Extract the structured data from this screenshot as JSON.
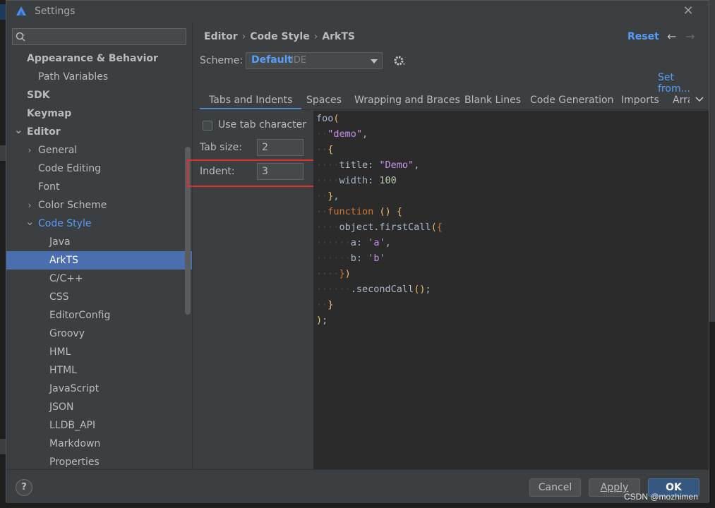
{
  "window": {
    "title": "Settings"
  },
  "search": {
    "placeholder": ""
  },
  "tree": [
    {
      "label": "Appearance & Behavior",
      "bold": true
    },
    {
      "label": "Path Variables"
    },
    {
      "label": "SDK",
      "bold": true
    },
    {
      "label": "Keymap",
      "bold": true
    },
    {
      "label": "Editor",
      "bold": true,
      "expanded": true
    },
    {
      "label": "General",
      "collapsed": true
    },
    {
      "label": "Code Editing"
    },
    {
      "label": "Font"
    },
    {
      "label": "Color Scheme",
      "collapsed": true
    },
    {
      "label": "Code Style",
      "expanded": true
    },
    {
      "label": "Java"
    },
    {
      "label": "ArkTS",
      "selected": true
    },
    {
      "label": "C/C++"
    },
    {
      "label": "CSS"
    },
    {
      "label": "EditorConfig"
    },
    {
      "label": "Groovy"
    },
    {
      "label": "HML"
    },
    {
      "label": "HTML"
    },
    {
      "label": "JavaScript"
    },
    {
      "label": "JSON"
    },
    {
      "label": "LLDB_API"
    },
    {
      "label": "Markdown"
    },
    {
      "label": "Properties"
    }
  ],
  "breadcrumb": [
    "Editor",
    "Code Style",
    "ArkTS"
  ],
  "header": {
    "reset_label": "Reset"
  },
  "scheme": {
    "label": "Scheme:",
    "name": "Default",
    "type": "IDE"
  },
  "set_from_label": "Set from...",
  "tabs": [
    "Tabs and Indents",
    "Spaces",
    "Wrapping and Braces",
    "Blank Lines",
    "Code Generation",
    "Imports",
    "Arra"
  ],
  "active_tab": "Tabs and Indents",
  "options": {
    "use_tab_label": "Use tab character",
    "use_tab_checked": false,
    "tab_size_label": "Tab size:",
    "tab_size_value": "2",
    "indent_label": "Indent:",
    "indent_value": "3"
  },
  "code_lines": [
    [
      [
        "",
        "foo"
      ],
      [
        "par",
        "("
      ]
    ],
    [
      [
        "ws",
        "··"
      ],
      [
        "str",
        "\"demo\""
      ],
      [
        "",
        ","
      ]
    ],
    [
      [
        "ws",
        "··"
      ],
      [
        "par",
        "{"
      ]
    ],
    [
      [
        "ws",
        "····"
      ],
      [
        "",
        "title"
      ],
      [
        "",
        ": "
      ],
      [
        "str",
        "\"Demo\""
      ],
      [
        "",
        ","
      ]
    ],
    [
      [
        "ws",
        "····"
      ],
      [
        "",
        "width"
      ],
      [
        "",
        ": "
      ],
      [
        "num",
        "100"
      ]
    ],
    [
      [
        "ws",
        "··"
      ],
      [
        "par",
        "}"
      ],
      [
        "",
        ","
      ]
    ],
    [
      [
        "ws",
        "··"
      ],
      [
        "key",
        "function"
      ],
      [
        "",
        " "
      ],
      [
        "par",
        "()"
      ],
      [
        "",
        " "
      ],
      [
        "par",
        "{"
      ]
    ],
    [
      [
        "ws",
        "····"
      ],
      [
        "",
        "object.firstCall"
      ],
      [
        "par",
        "("
      ],
      [
        "key",
        "{"
      ]
    ],
    [
      [
        "ws",
        "······"
      ],
      [
        "",
        "a"
      ],
      [
        "",
        ": "
      ],
      [
        "str",
        "'a'"
      ],
      [
        "",
        ","
      ]
    ],
    [
      [
        "ws",
        "······"
      ],
      [
        "",
        "b"
      ],
      [
        "",
        ": "
      ],
      [
        "str",
        "'b'"
      ]
    ],
    [
      [
        "ws",
        "····"
      ],
      [
        "key",
        "}"
      ],
      [
        "par",
        ")"
      ]
    ],
    [
      [
        "ws",
        "······"
      ],
      [
        "",
        ".secondCall"
      ],
      [
        "par",
        "()"
      ],
      [
        "",
        ";"
      ]
    ],
    [
      [
        "ws",
        "··"
      ],
      [
        "par",
        "}"
      ]
    ],
    [
      [
        "par",
        ")"
      ],
      [
        "",
        ";"
      ]
    ]
  ],
  "footer": {
    "help_label": "?",
    "cancel_label": "Cancel",
    "apply_label": "Apply",
    "ok_label": "OK"
  },
  "watermark": "CSDN @mozhimen",
  "colors": {
    "accent": "#589df6",
    "selection": "#4b6eaf",
    "highlight_box": "#e0302a"
  }
}
